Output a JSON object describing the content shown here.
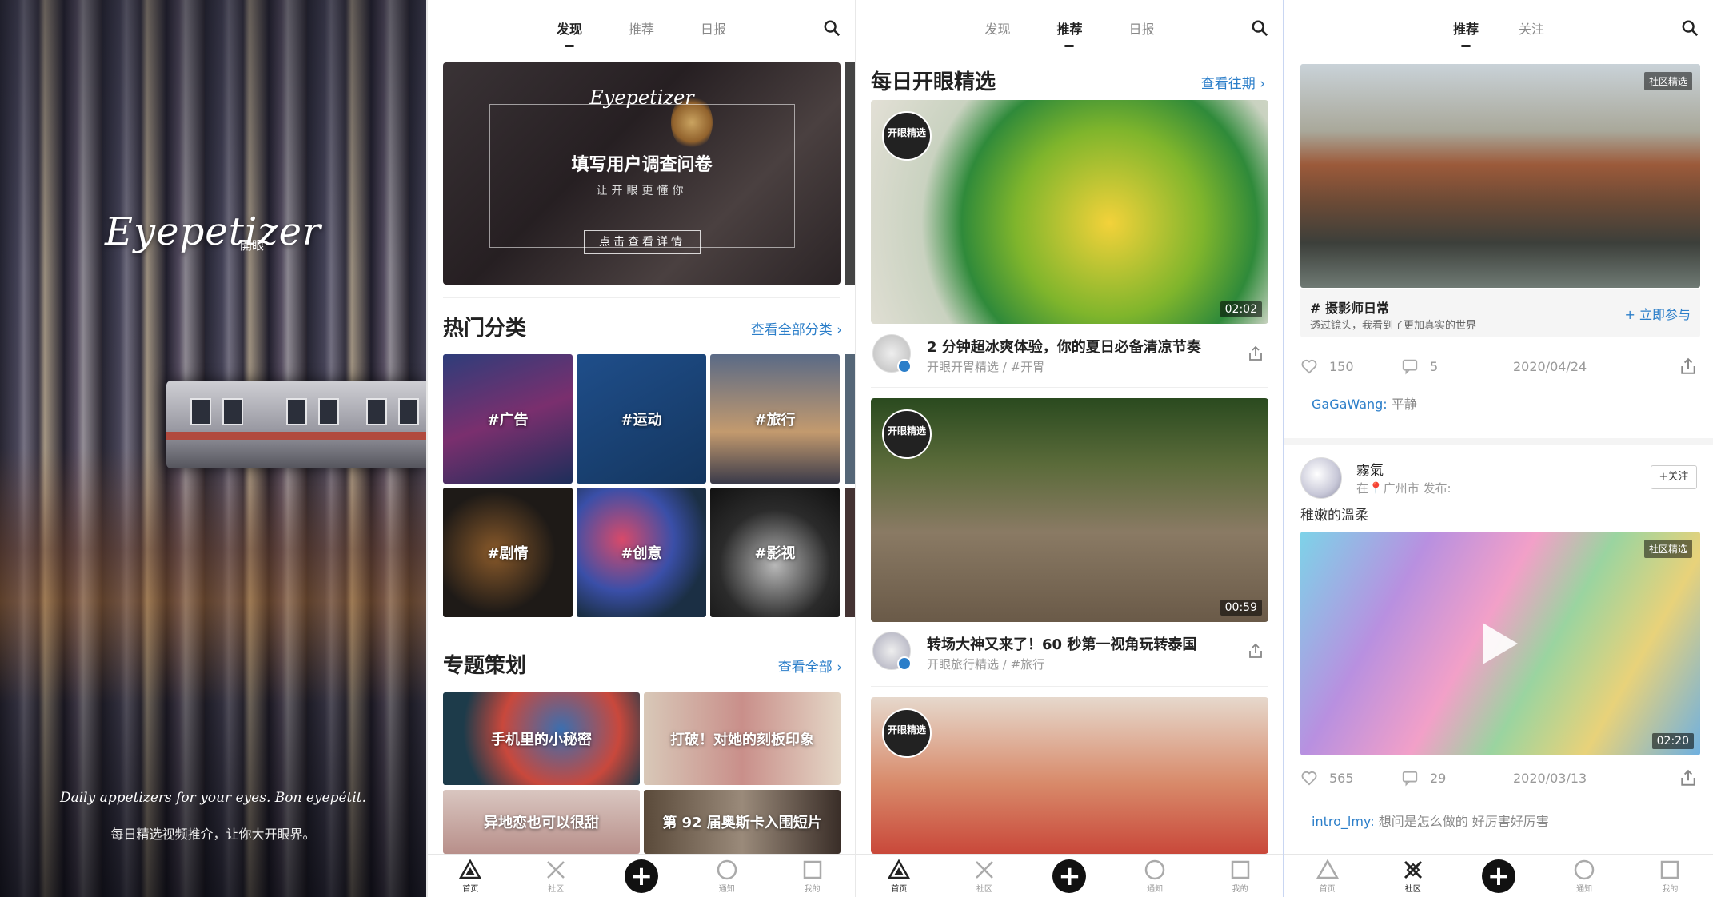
{
  "splash": {
    "logo": "Eyepetizer",
    "logo_cn": "開眼",
    "tagline": "Daily appetizers for your eyes. Bon eyepétit.",
    "tagline_cn": "每日精选视频推介，让你大开眼界。"
  },
  "discover": {
    "tabs": [
      "发现",
      "推荐",
      "日报"
    ],
    "active_tab": "发现",
    "banner": {
      "brand": "Eyepetizer",
      "title": "填写用户调查问卷",
      "subtitle": "让开眼更懂你",
      "button": "点击查看详情"
    },
    "hot_categories": {
      "title": "热门分类",
      "more": "查看全部分类",
      "items": [
        "#广告",
        "#运动",
        "#旅行",
        "#剧情",
        "#创意",
        "#影视"
      ]
    },
    "topics": {
      "title": "专题策划",
      "more": "查看全部",
      "items": [
        "手机里的小秘密",
        "打破！对她的刻板印象",
        "异地恋也可以很甜",
        "第 92 届奥斯卡入围短片"
      ]
    }
  },
  "recommend": {
    "tabs": [
      "发现",
      "推荐",
      "日报"
    ],
    "active_tab": "推荐",
    "section_title": "每日开眼精选",
    "section_more": "查看往期",
    "badge": "开眼精选",
    "videos": [
      {
        "title": "2 分钟超冰爽体验，你的夏日必备清凉节奏",
        "meta": "开眼开胃精选  /  #开胃",
        "duration": "02:02"
      },
      {
        "title": "转场大神又来了！60 秒第一视角玩转泰国",
        "meta": "开眼旅行精选  /  #旅行",
        "duration": "00:59"
      },
      {
        "title": "",
        "meta": "",
        "duration": ""
      }
    ]
  },
  "community": {
    "tabs": [
      "推荐",
      "关注"
    ],
    "active_tab": "推荐",
    "badge": "社区精选",
    "post1": {
      "tag_title": "# 摄影师日常",
      "tag_desc": "透过镜头，我看到了更加真实的世界",
      "join": "+ 立即参与",
      "likes": "150",
      "comments": "5",
      "date": "2020/04/24",
      "comment_user": "GaGaWang:",
      "comment_text": "平静"
    },
    "post2": {
      "author": "霧氣",
      "location": "在📍广州市 发布:",
      "follow": "+关注",
      "caption": "稚嫩的溫柔",
      "duration": "02:20",
      "likes": "565",
      "comments": "29",
      "date": "2020/03/13",
      "comment_user": "intro_lmy:",
      "comment_text": "想问是怎么做的 好厉害好厉害"
    }
  },
  "bottom_nav": [
    "首页",
    "社区",
    "",
    "通知",
    "我的"
  ]
}
